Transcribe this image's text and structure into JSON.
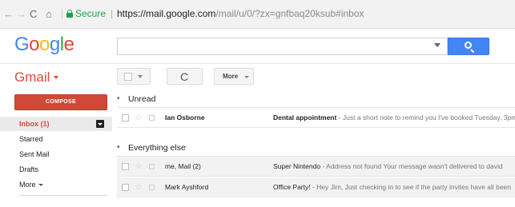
{
  "browser": {
    "nav_back": "←",
    "nav_forward": "→",
    "nav_reload": "C",
    "nav_home": "⌂",
    "secure_label": "Secure",
    "url_separator": "|",
    "url_host": "https://mail.google.com",
    "url_path": "/mail/u/0/?zx=gnfbaq20ksub#inbox"
  },
  "google_logo": [
    "G",
    "o",
    "o",
    "g",
    "l",
    "e"
  ],
  "search": {
    "placeholder": "",
    "button_icon": "search-icon"
  },
  "gmail": {
    "label": "Gmail"
  },
  "toolbar": {
    "refresh_glyph": "C",
    "more_label": "More"
  },
  "sidebar": {
    "compose_label": "COMPOSE",
    "items": [
      {
        "label": "Inbox (1)",
        "active": true
      },
      {
        "label": "Starred",
        "active": false
      },
      {
        "label": "Sent Mail",
        "active": false
      },
      {
        "label": "Drafts",
        "active": false
      },
      {
        "label": "More",
        "active": false
      }
    ]
  },
  "sections": [
    {
      "title": "Unread",
      "toggle": "▾",
      "messages": [
        {
          "sender": "Ian Osborne",
          "subject": "Dental appointment",
          "snippet": " - Just a short note to remind you I've booked Tuesday, 3pm",
          "unread": true
        }
      ]
    },
    {
      "title": "Everything else",
      "toggle": "▾",
      "messages": [
        {
          "sender": "me, Mail (2)",
          "subject": "Super Nintendo",
          "snippet": " - Address not found Your message wasn't delivered to david",
          "unread": false
        },
        {
          "sender": "Mark Ayshford",
          "subject": "Office Party!",
          "snippet": " - Hey Jim, Just checking in to see if the party invites have all been",
          "unread": false
        }
      ]
    }
  ],
  "colors": {
    "google_blue": "#4285f4",
    "gmail_red": "#dd4b39",
    "compose_red": "#d14836",
    "secure_green": "#19a34a"
  }
}
